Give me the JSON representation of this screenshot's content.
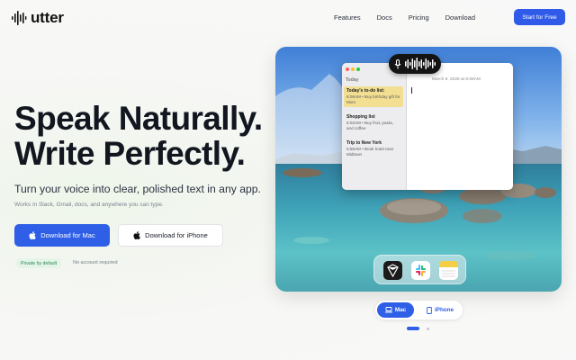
{
  "brand": {
    "name": "utter"
  },
  "nav": {
    "links": [
      "Features",
      "Docs",
      "Pricing",
      "Download"
    ],
    "cta": "Start for Free"
  },
  "hero": {
    "headline_line1": "Speak Naturally.",
    "headline_line2": "Write Perfectly.",
    "subhead": "Turn your voice into clear, polished text in any app.",
    "works_in": "Works in Slack, Gmail, docs, and anywhere you can type.",
    "download_mac": "Download for Mac",
    "download_iphone": "Download for iPhone",
    "badge_private": "Private by default",
    "no_account": "No account required"
  },
  "notes_app": {
    "section": "Today",
    "date": "March 9, 2026 at 6:08AM",
    "notes": [
      {
        "title": "Today's to-do list:",
        "body": "6:08AM • Buy birthday gift for Mom"
      },
      {
        "title": "Shopping list",
        "body": "6:03AM • Buy fruit, pasta, and coffee"
      },
      {
        "title": "Trip to New York",
        "body": "5:58AM • Book hotel near Midtown"
      }
    ]
  },
  "dock": {
    "apps": [
      "cursor-app-icon",
      "slack-app-icon",
      "notes-app-icon"
    ]
  },
  "platform_toggle": {
    "mac": "Mac",
    "iphone": "iPhone",
    "active": "Mac"
  },
  "carousel": {
    "active_index": 0,
    "count": 2
  },
  "colors": {
    "accent": "#2e5fe6",
    "headline": "#12161f",
    "private_badge_bg": "#e3f4e8",
    "private_badge_text": "#2e8a52",
    "note_selected": "#f3df92"
  }
}
